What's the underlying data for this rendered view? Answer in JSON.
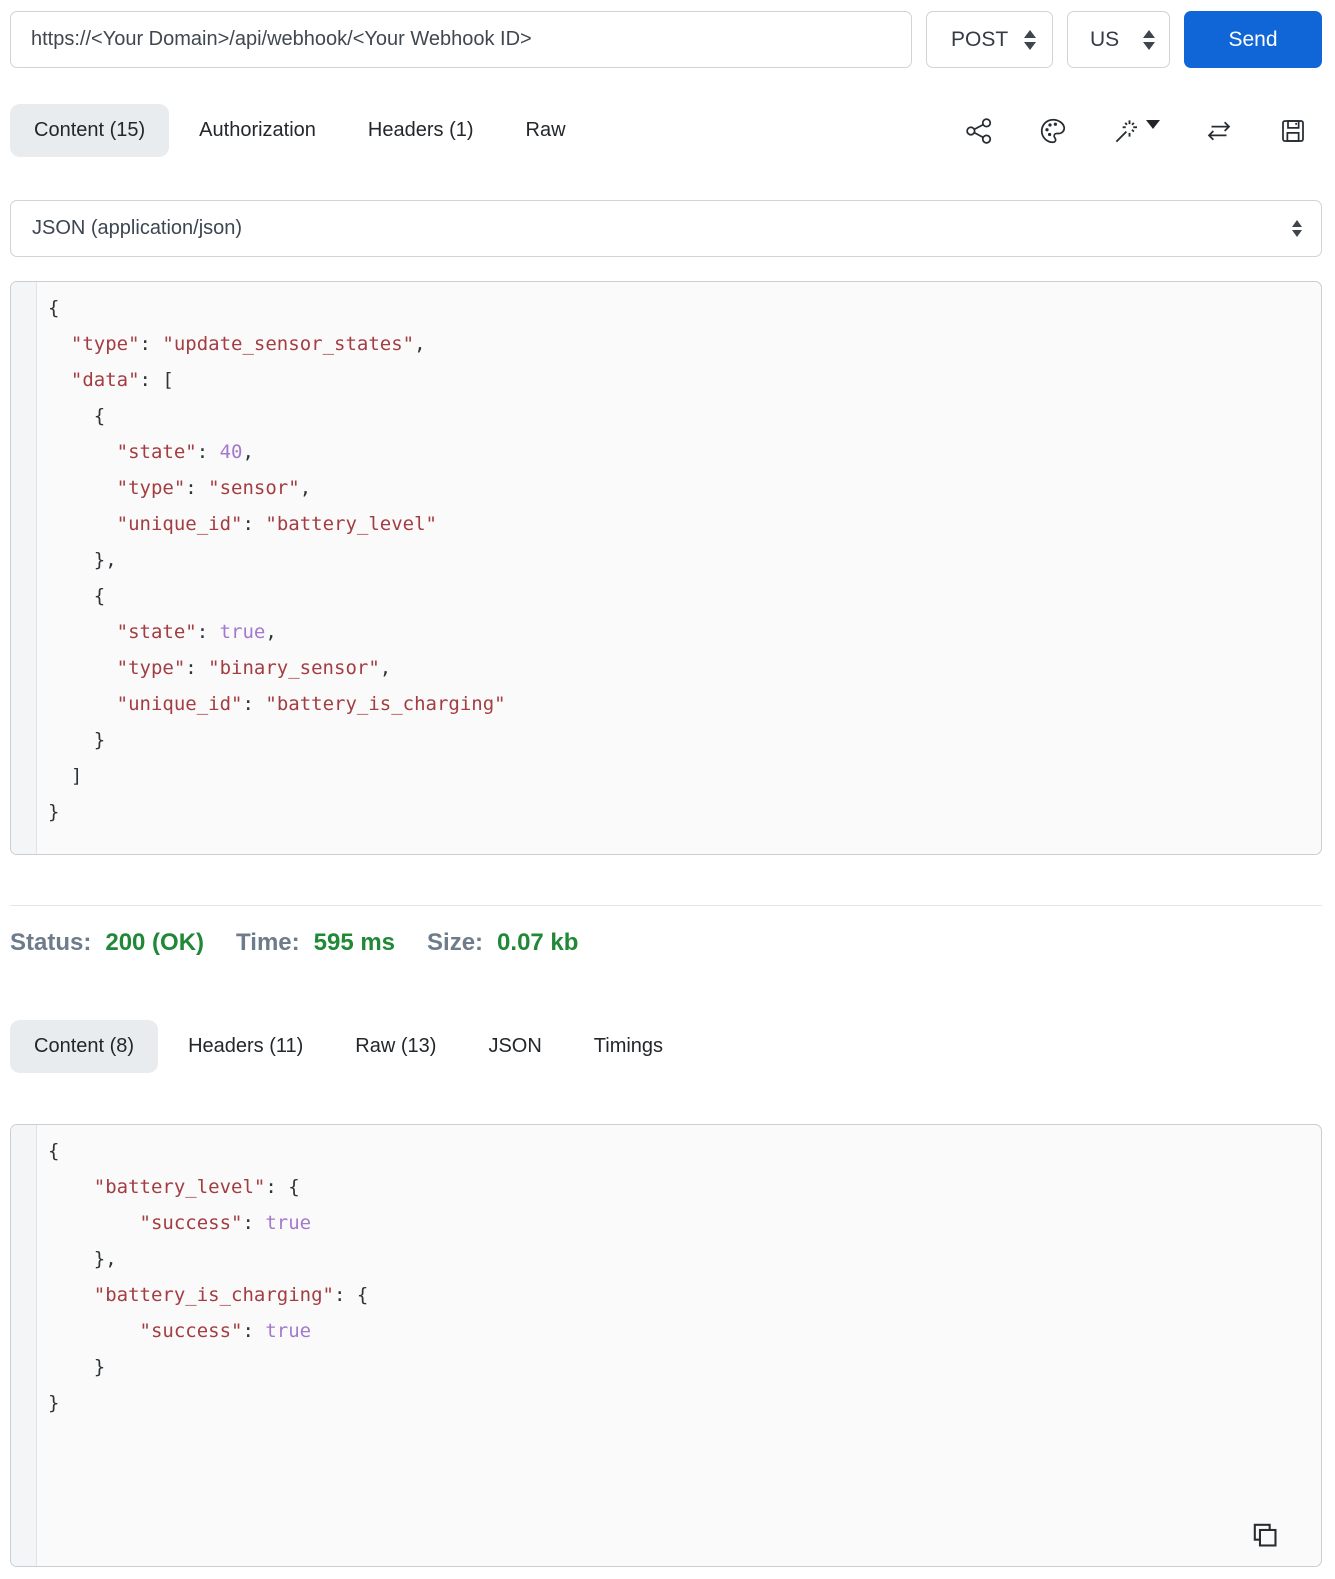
{
  "request_bar": {
    "url": "https://<Your Domain>/api/webhook/<Your Webhook ID>",
    "method": "POST",
    "region": "US",
    "send_label": "Send"
  },
  "request_tabs": [
    {
      "label": "Content (15)",
      "active": true
    },
    {
      "label": "Authorization",
      "active": false
    },
    {
      "label": "Headers (1)",
      "active": false
    },
    {
      "label": "Raw",
      "active": false
    }
  ],
  "toolbar": {
    "icons": [
      "share-icon",
      "palette-icon",
      "magic-wand-icon",
      "swap-arrows-icon",
      "save-icon"
    ]
  },
  "content_type": {
    "value": "JSON (application/json)"
  },
  "request_body": {
    "lines": [
      "{",
      "  \"type\": \"update_sensor_states\",",
      "  \"data\": [",
      "    {",
      "      \"state\": 40,",
      "      \"type\": \"sensor\",",
      "      \"unique_id\": \"battery_level\"",
      "    },",
      "    {",
      "      \"state\": true,",
      "      \"type\": \"binary_sensor\",",
      "      \"unique_id\": \"battery_is_charging\"",
      "    }",
      "  ]",
      "}"
    ]
  },
  "status_bar": {
    "status_label": "Status:",
    "status_value": "200 (OK)",
    "time_label": "Time:",
    "time_value": "595 ms",
    "size_label": "Size:",
    "size_value": "0.07 kb"
  },
  "response_tabs": [
    {
      "label": "Content (8)",
      "active": true
    },
    {
      "label": "Headers (11)",
      "active": false
    },
    {
      "label": "Raw (13)",
      "active": false
    },
    {
      "label": "JSON",
      "active": false
    },
    {
      "label": "Timings",
      "active": false
    }
  ],
  "response_body": {
    "lines": [
      "{",
      "    \"battery_level\": {",
      "        \"success\": true",
      "    },",
      "    \"battery_is_charging\": {",
      "        \"success\": true",
      "    }",
      "}"
    ]
  },
  "colors": {
    "accent_blue": "#1066d6",
    "status_green": "#218838",
    "active_tab_bg": "#e9ecef",
    "code_string": "#a33d41",
    "code_literal": "#a379cd"
  }
}
